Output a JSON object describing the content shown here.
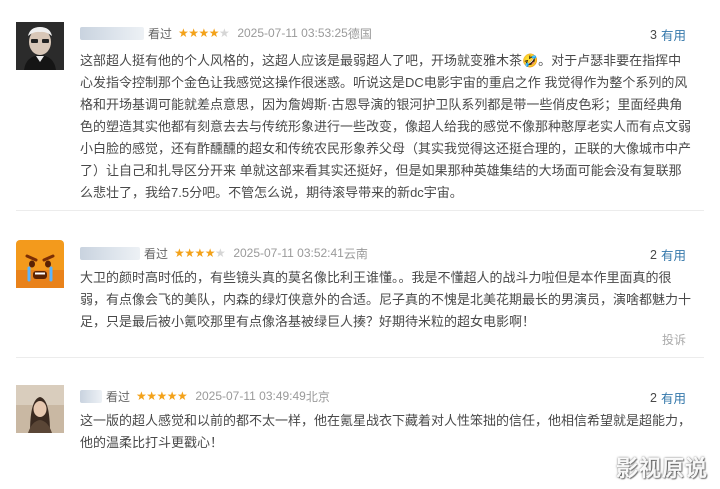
{
  "reviews": [
    {
      "status": "看过",
      "rating": 4,
      "date": "2025-07-11 03:53:25",
      "location": "德国",
      "useful_count": "3",
      "useful_label": "有用",
      "lines": [
        "这部超人挺有他的个人风格的，这超人应该是最弱超人了吧，开场就变雅木茶🤣。对于卢瑟非要在指挥中",
        "心发指令控制那个金色让我感觉这操作很迷惑。听说这是DC电影宇宙的重启之作 我觉得作为整个系列的风",
        "格和开场基调可能就差点意思，因为詹姆斯·古恩导演的银河护卫队系列都是带一些俏皮色彩；里面经典角",
        "色的塑造其实他都有刻意去去与传统形象进行一些改变，像超人给我的感觉不像那种憨厚老实人而有点文弱",
        "小白脸的感觉，还有酢醺醺的超女和传统农民形象养父母（其实我觉得这还挺合理的，正联的大像城市中产",
        "了）让自己和扎导区分开来 单就这部来看其实还挺好，但是如果那种英雄集结的大场面可能会没有复联那",
        "么悲壮了，我给7.5分吧。不管怎么说，期待滚导带来的新dc宇宙。"
      ]
    },
    {
      "status": "看过",
      "rating": 4,
      "date": "2025-07-11 03:52:41",
      "location": "云南",
      "useful_count": "2",
      "useful_label": "有用",
      "report": "投诉",
      "lines": [
        "大卫的颜时高时低的，有些镜头真的莫名像比利王谁懂。。我是不懂超人的战斗力啦但是本作里面真的很",
        "弱，有点像会飞的美队，内森的绿灯侠意外的合适。尼子真的不愧是北美花期最长的男演员，演啥都魅力十",
        "足，只是最后被小氪咬那里有点像洛基被绿巨人揍？好期待米粒的超女电影啊！"
      ]
    },
    {
      "status": "看过",
      "rating": 5,
      "date": "2025-07-11 03:49:49",
      "location": "北京",
      "useful_count": "2",
      "useful_label": "有用",
      "lines": [
        "这一版的超人感觉和以前的都不太一样，他在氪星战衣下藏着对人性笨拙的信任，他相信希望就是超能力，",
        "他的温柔比打斗更戳心！"
      ]
    }
  ],
  "watermark": "影视原说",
  "colors": {
    "star": "#f3a21a",
    "link": "#3377aa",
    "text": "#494949",
    "meta": "#9a9a9a"
  }
}
